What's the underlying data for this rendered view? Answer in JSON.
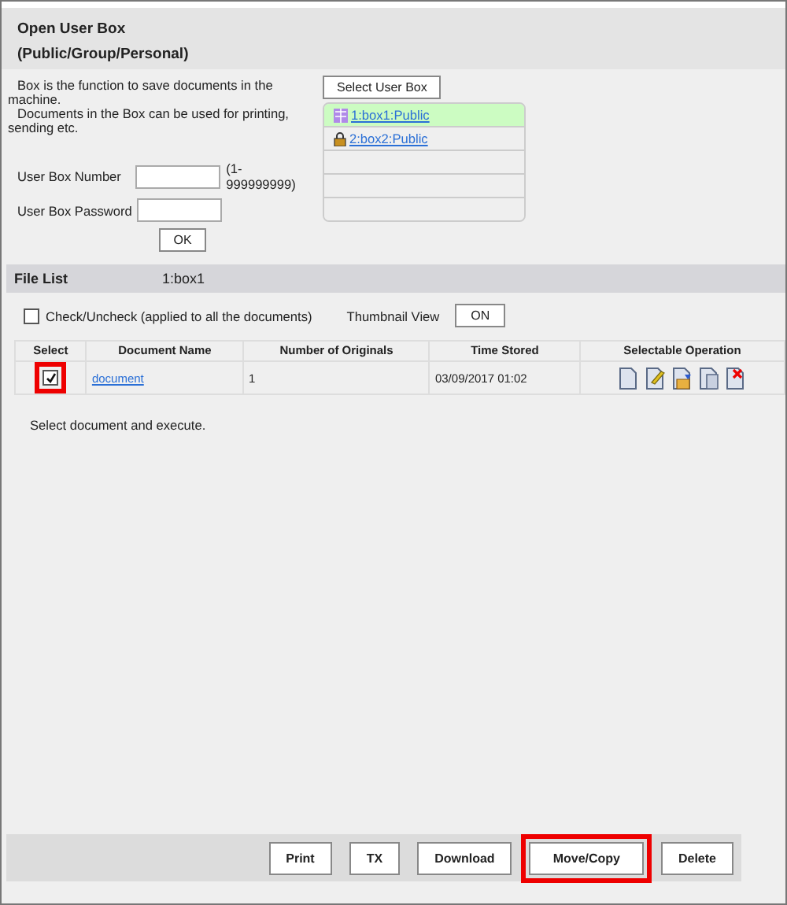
{
  "title_lines": [
    "Open User Box",
    "(Public/Group/Personal)"
  ],
  "description": [
    "Box is the function to save documents in the machine.",
    "Documents in the Box can be used for printing, sending etc."
  ],
  "fields": [
    {
      "label": "User Box Number",
      "hint": "(1-999999999)"
    },
    {
      "label": "User Box Password"
    }
  ],
  "ok_button": "OK",
  "select_box_button": "Select User Box",
  "boxes": [
    {
      "kind": "public",
      "label": "1:box1:Public",
      "selected": true
    },
    {
      "kind": "locked",
      "label": "2:box2:Public",
      "selected": false
    }
  ],
  "file_list": {
    "title": "File List",
    "box": "1:box1"
  },
  "check_all": {
    "label": "Check/Uncheck (applied to all the documents)",
    "checked": false
  },
  "thumbnail": {
    "label": "Thumbnail View",
    "button": "ON"
  },
  "table": {
    "columns": [
      "Select",
      "Document Name",
      "Number of Originals",
      "Time Stored",
      "Selectable Operation"
    ],
    "rows": [
      {
        "checked": true,
        "highlighted": true,
        "name": "document",
        "originals": "1",
        "time": "03/09/2017 01:02",
        "operations": [
          {
            "kind": "preview"
          },
          {
            "kind": "edit"
          },
          {
            "kind": "send"
          },
          {
            "kind": "copy"
          },
          {
            "kind": "delete"
          }
        ]
      }
    ]
  },
  "hint": "Select document and execute.",
  "actions": [
    {
      "label": "Print",
      "highlighted": false
    },
    {
      "label": "TX",
      "highlighted": false
    },
    {
      "label": "Download",
      "highlighted": false
    },
    {
      "label": "Move/Copy",
      "highlighted": true
    },
    {
      "label": "Delete",
      "highlighted": false
    }
  ]
}
